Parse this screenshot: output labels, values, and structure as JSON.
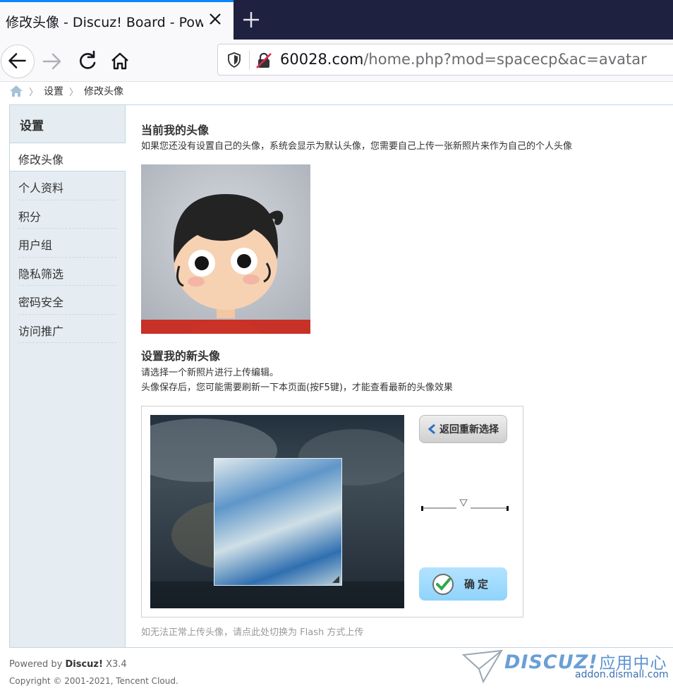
{
  "browser": {
    "tab_title": "修改头像 - Discuz! Board - Powered by Discuz!",
    "url_domain": "60028.com",
    "url_path": "/home.php?mod=spacecp&ac=avatar"
  },
  "breadcrumb": {
    "items": [
      "设置",
      "修改头像"
    ]
  },
  "sidebar": {
    "heading": "设置",
    "items": [
      {
        "label": "修改头像",
        "active": true
      },
      {
        "label": "个人资料"
      },
      {
        "label": "积分"
      },
      {
        "label": "用户组"
      },
      {
        "label": "隐私筛选"
      },
      {
        "label": "密码安全"
      },
      {
        "label": "访问推广"
      }
    ]
  },
  "main": {
    "current_title": "当前我的头像",
    "current_desc": "如果您还没有设置自己的头像，系统会显示为默认头像，您需要自己上传一张新照片来作为自己的个人头像",
    "new_title": "设置我的新头像",
    "new_desc_1": "请选择一个新照片进行上传编辑。",
    "new_desc_2": "头像保存后，您可能需要刷新一下本页面(按F5键)，才能查看最新的头像效果",
    "back_button": "返回重新选择",
    "ok_button": "确定",
    "flash_link": "如无法正常上传头像，请点此处切换为 Flash 方式上传"
  },
  "footer": {
    "powered_prefix": "Powered by ",
    "powered_brand": "Discuz!",
    "powered_version": " X3.4",
    "copyright": "Copyright © 2001-2021, Tencent Cloud.",
    "watermark_logo": "DISCUZ!",
    "watermark_cn": "应用中心",
    "watermark_url": "addon.dismall.com"
  },
  "colors": {
    "accent": "#0a84ff",
    "sidebar_bg": "#e5edf2",
    "border": "#c2d5e3",
    "ok_button": "#9ad8fd"
  }
}
